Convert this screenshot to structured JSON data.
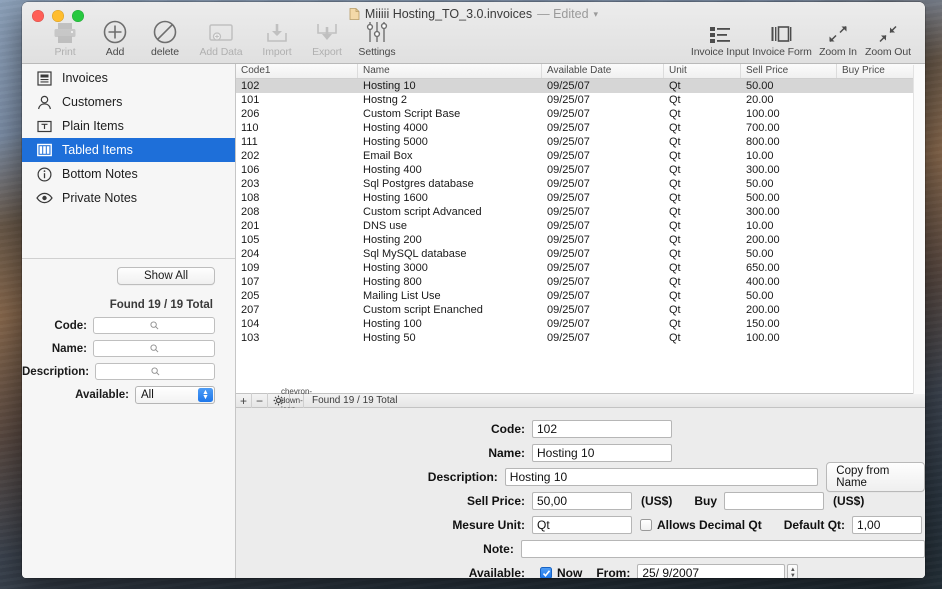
{
  "window": {
    "title": "Miiiii Hosting_TO_3.0.invoices",
    "edited_suffix": "— Edited",
    "doc_icon": "document-icon",
    "chevron": "chevron-down-icon"
  },
  "toolbar": {
    "left": [
      {
        "label": "Print",
        "icon": "printer-icon",
        "disabled": true
      },
      {
        "label": "Add",
        "icon": "plus-circle-icon",
        "disabled": false
      },
      {
        "label": "delete",
        "icon": "no-entry-icon",
        "disabled": false
      },
      {
        "label": "Add Data",
        "icon": "add-data-icon",
        "disabled": true
      },
      {
        "label": "Import",
        "icon": "import-icon",
        "disabled": true
      },
      {
        "label": "Export",
        "icon": "export-icon",
        "disabled": true
      },
      {
        "label": "Settings",
        "icon": "sliders-icon",
        "disabled": false
      }
    ],
    "right": [
      {
        "label": "Invoice Input",
        "icon": "list-icon",
        "disabled": false
      },
      {
        "label": "Invoice Form",
        "icon": "form-icon",
        "disabled": false
      },
      {
        "label": "Zoom In",
        "icon": "zoom-in-icon",
        "disabled": false
      },
      {
        "label": "Zoom Out",
        "icon": "zoom-out-icon",
        "disabled": false
      }
    ]
  },
  "sidebar": {
    "items": [
      {
        "label": "Invoices",
        "icon": "invoice-icon",
        "selected": false
      },
      {
        "label": "Customers",
        "icon": "person-icon",
        "selected": false
      },
      {
        "label": "Plain Items",
        "icon": "text-box-icon",
        "selected": false
      },
      {
        "label": "Tabled Items",
        "icon": "columns-icon",
        "selected": true
      },
      {
        "label": "Bottom Notes",
        "icon": "info-icon",
        "selected": false
      },
      {
        "label": "Private Notes",
        "icon": "eye-icon",
        "selected": false
      }
    ],
    "show_all_label": "Show All",
    "found_label": "Found 19 / 19 Total",
    "filters": [
      {
        "label": "Code:",
        "value": "",
        "icon": "search-icon"
      },
      {
        "label": "Name:",
        "value": "",
        "icon": "search-icon"
      },
      {
        "label": "Description:",
        "value": "",
        "icon": "search-icon"
      }
    ],
    "available": {
      "label": "Available:",
      "value": "All"
    }
  },
  "table": {
    "columns": [
      "Code1",
      "Name",
      "Available Date",
      "Unit",
      "Sell Price",
      "Buy Price"
    ],
    "rows": [
      {
        "code": "102",
        "name": "Hosting 10",
        "date": "09/25/07",
        "unit": "Qt",
        "sell": "50.00",
        "buy": "",
        "selected": true
      },
      {
        "code": "101",
        "name": "Hostng 2",
        "date": "09/25/07",
        "unit": "Qt",
        "sell": "20.00",
        "buy": "",
        "selected": false
      },
      {
        "code": "206",
        "name": "Custom Script Base",
        "date": "09/25/07",
        "unit": "Qt",
        "sell": "100.00",
        "buy": "",
        "selected": false
      },
      {
        "code": "110",
        "name": "Hosting 4000",
        "date": "09/25/07",
        "unit": "Qt",
        "sell": "700.00",
        "buy": "",
        "selected": false
      },
      {
        "code": "111",
        "name": "Hosting 5000",
        "date": "09/25/07",
        "unit": "Qt",
        "sell": "800.00",
        "buy": "",
        "selected": false
      },
      {
        "code": "202",
        "name": "Email Box",
        "date": "09/25/07",
        "unit": "Qt",
        "sell": "10.00",
        "buy": "",
        "selected": false
      },
      {
        "code": "106",
        "name": "Hosting 400",
        "date": "09/25/07",
        "unit": "Qt",
        "sell": "300.00",
        "buy": "",
        "selected": false
      },
      {
        "code": "203",
        "name": "Sql Postgres database",
        "date": "09/25/07",
        "unit": "Qt",
        "sell": "50.00",
        "buy": "",
        "selected": false
      },
      {
        "code": "108",
        "name": "Hosting 1600",
        "date": "09/25/07",
        "unit": "Qt",
        "sell": "500.00",
        "buy": "",
        "selected": false
      },
      {
        "code": "208",
        "name": "Custom script Advanced",
        "date": "09/25/07",
        "unit": "Qt",
        "sell": "300.00",
        "buy": "",
        "selected": false
      },
      {
        "code": "201",
        "name": "DNS use",
        "date": "09/25/07",
        "unit": "Qt",
        "sell": "10.00",
        "buy": "",
        "selected": false
      },
      {
        "code": "105",
        "name": "Hosting 200",
        "date": "09/25/07",
        "unit": "Qt",
        "sell": "200.00",
        "buy": "",
        "selected": false
      },
      {
        "code": "204",
        "name": "Sql MySQL database",
        "date": "09/25/07",
        "unit": "Qt",
        "sell": "50.00",
        "buy": "",
        "selected": false
      },
      {
        "code": "109",
        "name": "Hosting 3000",
        "date": "09/25/07",
        "unit": "Qt",
        "sell": "650.00",
        "buy": "",
        "selected": false
      },
      {
        "code": "107",
        "name": "Hosting 800",
        "date": "09/25/07",
        "unit": "Qt",
        "sell": "400.00",
        "buy": "",
        "selected": false
      },
      {
        "code": "205",
        "name": "Mailing List Use",
        "date": "09/25/07",
        "unit": "Qt",
        "sell": "50.00",
        "buy": "",
        "selected": false
      },
      {
        "code": "207",
        "name": "Custom script Enanched",
        "date": "09/25/07",
        "unit": "Qt",
        "sell": "200.00",
        "buy": "",
        "selected": false
      },
      {
        "code": "104",
        "name": "Hosting 100",
        "date": "09/25/07",
        "unit": "Qt",
        "sell": "150.00",
        "buy": "",
        "selected": false
      },
      {
        "code": "103",
        "name": "Hosting 50",
        "date": "09/25/07",
        "unit": "Qt",
        "sell": "100.00",
        "buy": "",
        "selected": false
      }
    ]
  },
  "recordbar": {
    "add": "+",
    "remove": "−",
    "gear": "gear-icon",
    "chevron": "chevron-down-icon",
    "status": "Found 19 / 19 Total"
  },
  "detail": {
    "code": {
      "label": "Code:",
      "value": "102"
    },
    "name": {
      "label": "Name:",
      "value": "Hosting 10"
    },
    "description": {
      "label": "Description:",
      "value": "Hosting 10",
      "copy_button": "Copy from Name"
    },
    "sell_price": {
      "label": "Sell Price:",
      "value": "50,00",
      "currency": "(US$)"
    },
    "buy_price": {
      "label": "Buy",
      "value": "",
      "currency": "(US$)"
    },
    "mesure_unit": {
      "label": "Mesure Unit:",
      "value": "Qt"
    },
    "allows_decimal": {
      "label": "Allows Decimal Qt",
      "checked": false
    },
    "default_qt": {
      "label": "Default Qt:",
      "value": "1,00"
    },
    "note": {
      "label": "Note:",
      "value": ""
    },
    "available": {
      "label": "Available:",
      "now_label": "Now",
      "now_checked": true,
      "from_label": "From:",
      "from_value": "25/  9/2007"
    }
  }
}
